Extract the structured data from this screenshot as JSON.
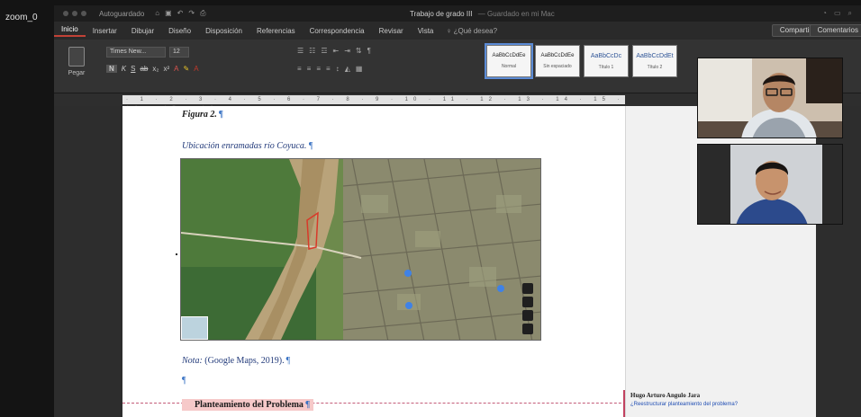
{
  "zoom": {
    "label": "zoom_0"
  },
  "titlebar": {
    "autosave": "Autoguardado",
    "doc_title": "Trabajo de grado III",
    "doc_status": "— Guardado en mi Mac"
  },
  "menu": {
    "items": [
      "Inicio",
      "Insertar",
      "Dibujar",
      "Diseño",
      "Disposición",
      "Referencias",
      "Correspondencia",
      "Revisar",
      "Vista"
    ],
    "active": "Inicio",
    "tell_me": "¿Qué desea?",
    "share": "Compartir",
    "comments": "Comentarios"
  },
  "ribbon": {
    "paste": "Pegar",
    "font_name": "Times New...",
    "font_size": "12",
    "styles": [
      {
        "preview": "AaBbCcDdEe",
        "name": "Normal"
      },
      {
        "preview": "AaBbCcDdEe",
        "name": "Sin espaciado"
      },
      {
        "preview": "AaBbCcDc",
        "name": "Título 1"
      },
      {
        "preview": "AaBbCcDdEt",
        "name": "Título 2"
      }
    ]
  },
  "document": {
    "figure_label": "Figura 2.",
    "figure_caption": "Ubicación enramadas río Coyuca.",
    "note_prefix": "Nota:",
    "note_text": "(Google Maps, 2019).",
    "paragraph_mark": "¶",
    "heading": "Planteamiento del Problema"
  },
  "comment": {
    "author": "Hugo Arturo Angulo Jara",
    "text": "¿Reestructurar planteamiento del problema?"
  },
  "colors": {
    "accent": "#c24236",
    "heading_highlight": "#f6c9c9",
    "caption_blue": "#223a7a"
  }
}
